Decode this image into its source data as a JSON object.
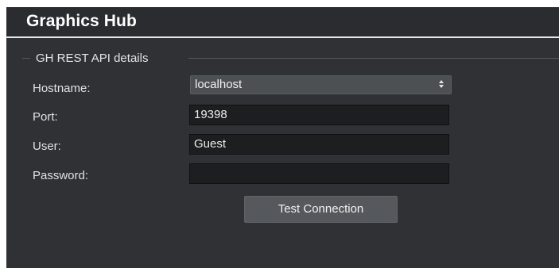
{
  "header": {
    "title": "Graphics Hub"
  },
  "group": {
    "legend": "GH REST API details"
  },
  "form": {
    "hostname": {
      "label": "Hostname:",
      "value": "localhost",
      "arrow_icon": "updown-chevron-icon"
    },
    "port": {
      "label": "Port:",
      "value": "19398"
    },
    "user": {
      "label": "User:",
      "value": "Guest"
    },
    "password": {
      "label": "Password:",
      "value": ""
    }
  },
  "actions": {
    "test_connection_label": "Test Connection"
  },
  "colors": {
    "panel_bg": "#2f3134",
    "field_bg": "#1d1e20",
    "button_bg": "#55585c",
    "text": "#e2e2e2"
  }
}
